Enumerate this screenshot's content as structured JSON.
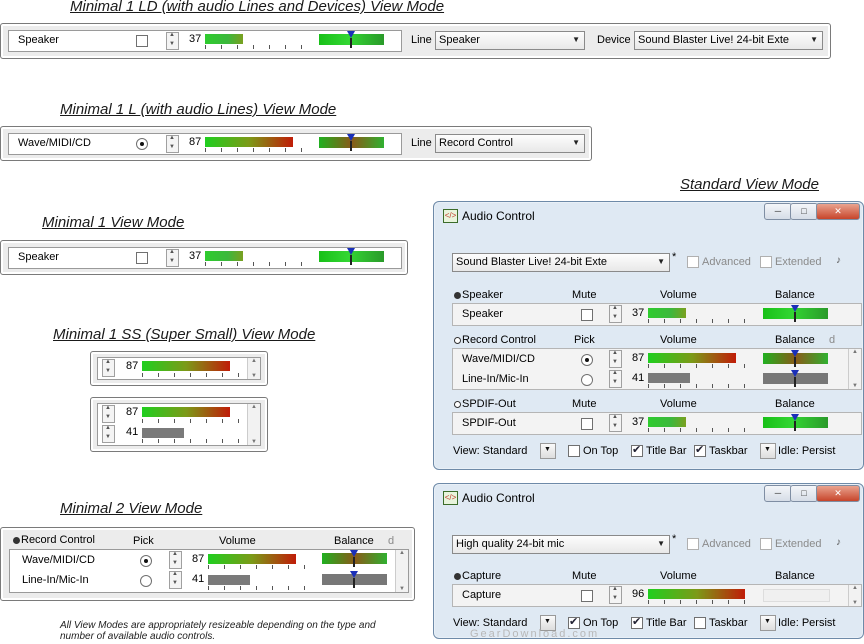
{
  "headings": {
    "ld": "Minimal 1 LD (with audio Lines and Devices) View Mode",
    "l": "Minimal 1 L (with audio Lines) View Mode",
    "m1": "Minimal 1 View Mode",
    "ss": "Minimal 1 SS (Super Small) View Mode",
    "m2": "Minimal 2 View Mode",
    "std": "Standard View Mode"
  },
  "footnote": "All View Modes are appropriately resizeable depending on the type and number of available audio controls.",
  "watermark": "GearDownload.com",
  "ld": {
    "name": "Speaker",
    "volume": "37",
    "line_label": "Line",
    "line_value": "Speaker",
    "device_label": "Device",
    "device_value": "Sound Blaster Live! 24-bit Exte"
  },
  "l": {
    "name": "Wave/MIDI/CD",
    "volume": "87",
    "line_label": "Line",
    "line_value": "Record Control"
  },
  "m1": {
    "name": "Speaker",
    "volume": "37"
  },
  "ss": {
    "a_volume": "87",
    "b_volume": "87",
    "c_volume": "41"
  },
  "m2": {
    "section": "Record Control",
    "col_pick": "Pick",
    "col_volume": "Volume",
    "col_balance": "Balance",
    "corner": "d",
    "rows": [
      {
        "name": "Wave/MIDI/CD",
        "volume": "87"
      },
      {
        "name": "Line-In/Mic-In",
        "volume": "41"
      }
    ]
  },
  "win1": {
    "title": "Audio Control",
    "device": "Sound Blaster Live! 24-bit Exte",
    "asterisk": "*",
    "advanced": "Advanced",
    "extended": "Extended",
    "col_mute": "Mute",
    "col_pick": "Pick",
    "col_volume": "Volume",
    "col_balance": "Balance",
    "speaker": {
      "head": "Speaker",
      "name": "Speaker",
      "volume": "37"
    },
    "record": {
      "head": "Record Control",
      "corner": "d",
      "rows": [
        {
          "name": "Wave/MIDI/CD",
          "volume": "87"
        },
        {
          "name": "Line-In/Mic-In",
          "volume": "41"
        }
      ]
    },
    "spdif": {
      "head": "SPDIF-Out",
      "name": "SPDIF-Out",
      "volume": "37"
    },
    "footer": {
      "view": "View: Standard",
      "ontop": "On Top",
      "titlebar": "Title Bar",
      "taskbar": "Taskbar",
      "idle": "Idle: Persist"
    }
  },
  "win2": {
    "title": "Audio Control",
    "device": "High quality 24-bit mic",
    "asterisk": "*",
    "advanced": "Advanced",
    "extended": "Extended",
    "col_mute": "Mute",
    "col_volume": "Volume",
    "col_balance": "Balance",
    "capture": {
      "head": "Capture",
      "name": "Capture",
      "volume": "96"
    },
    "footer": {
      "view": "View: Standard",
      "ontop": "On Top",
      "titlebar": "Title Bar",
      "taskbar": "Taskbar",
      "idle": "Idle: Persist"
    }
  },
  "colors": {
    "accent_green": "#2ecc2e",
    "accent_red": "#c01c08",
    "marker_blue": "#1a2fb8",
    "window_frame": "#dfe9f3"
  }
}
